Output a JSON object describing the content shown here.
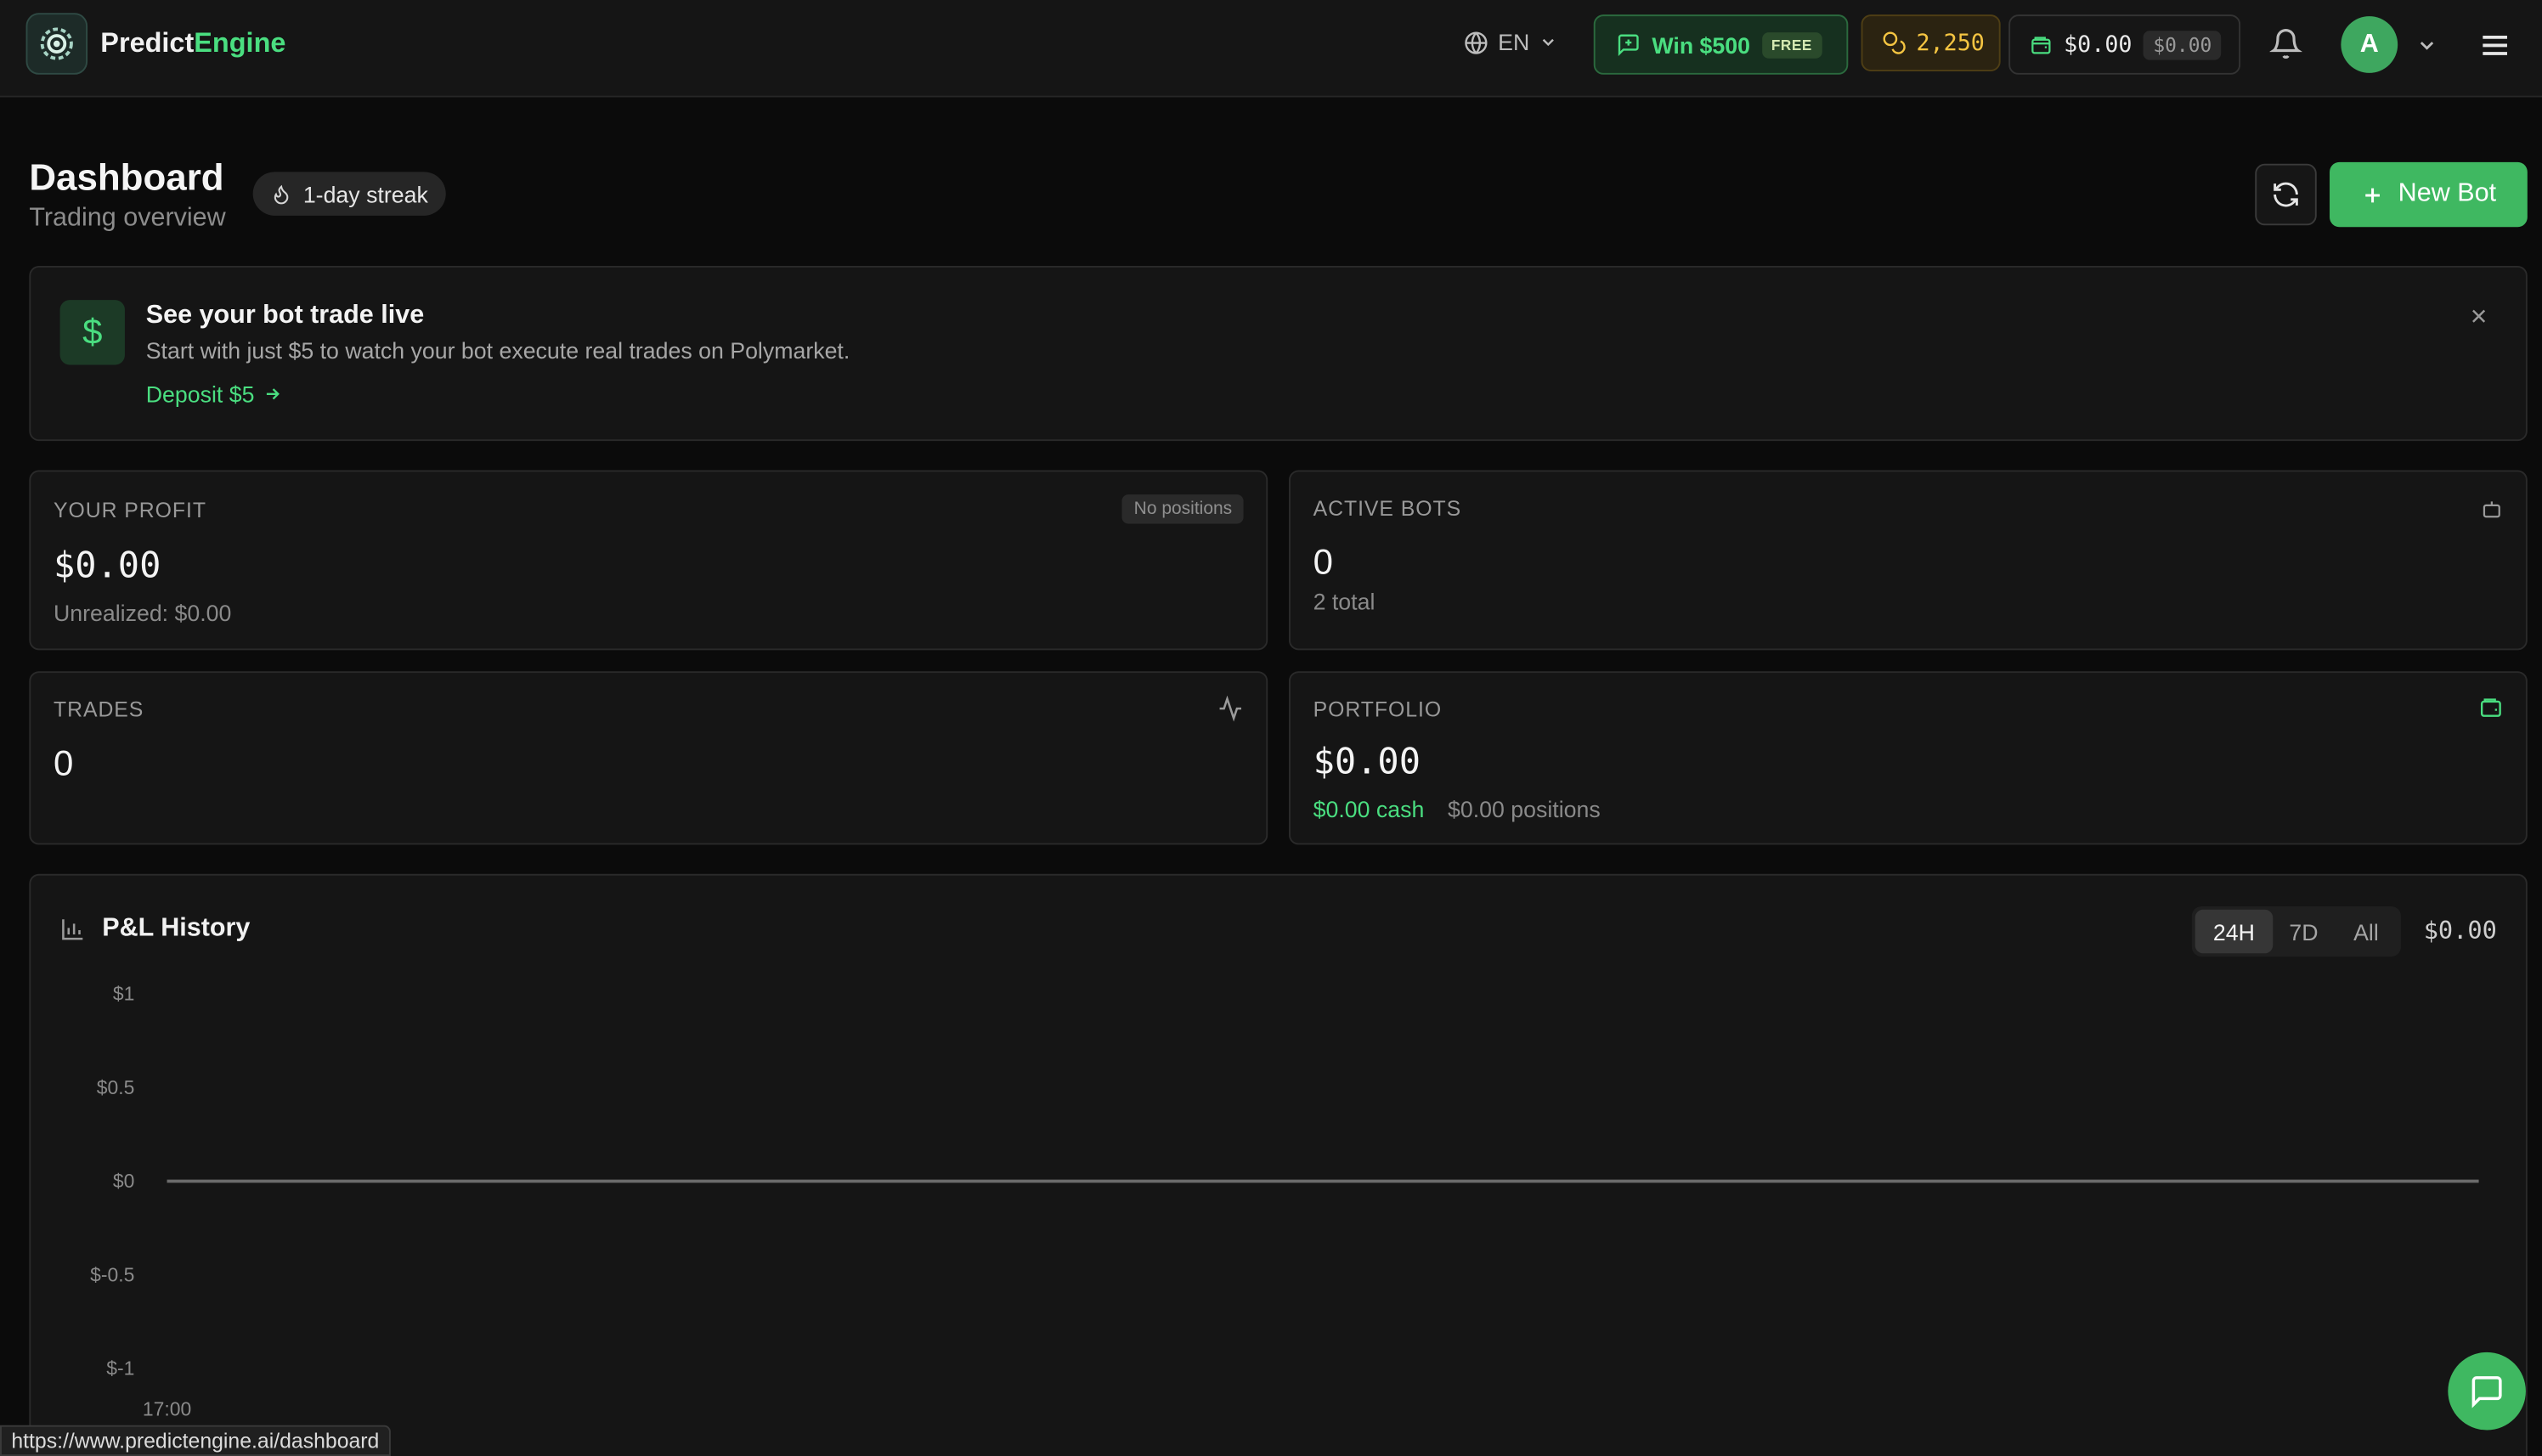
{
  "header": {
    "brand_part1": "Predict",
    "brand_part2": "Engine",
    "language": "EN",
    "win_label": "Win $500",
    "win_badge": "FREE",
    "coins": "2,250",
    "wallet_balance": "$0.00",
    "wallet_secondary": "$0.00",
    "avatar_initial": "A"
  },
  "page": {
    "title": "Dashboard",
    "subtitle": "Trading overview",
    "streak": "1-day streak",
    "new_bot_label": "New Bot"
  },
  "promo": {
    "title": "See your bot trade live",
    "text": "Start with just $5 to watch your bot execute real trades on Polymarket.",
    "link": "Deposit $5"
  },
  "stats": {
    "profit": {
      "label": "YOUR PROFIT",
      "badge": "No positions",
      "value": "$0.00",
      "sub": "Unrealized: $0.00"
    },
    "active_bots": {
      "label": "ACTIVE BOTS",
      "value": "0",
      "sub": "2 total"
    },
    "trades": {
      "label": "TRADES",
      "value": "0"
    },
    "portfolio": {
      "label": "PORTFOLIO",
      "value": "$0.00",
      "cash": "$0.00 cash",
      "positions": "$0.00 positions"
    }
  },
  "chart": {
    "title": "P&L History",
    "ranges": [
      "24H",
      "7D",
      "All"
    ],
    "active_range": "24H",
    "total": "$0.00"
  },
  "chart_data": {
    "type": "line",
    "title": "P&L History",
    "x": [
      "17:00"
    ],
    "x_tick_labels": [
      "17:00"
    ],
    "y_tick_labels": [
      "$1",
      "$0.5",
      "$0",
      "$-0.5",
      "$-1"
    ],
    "ylim": [
      -1,
      1
    ],
    "series": [
      {
        "values": [
          0,
          0
        ]
      }
    ],
    "grid": false,
    "colors": {
      "line": "#6b6b6b"
    }
  },
  "status_url": "https://www.predictengine.ai/dashboard",
  "colors": {
    "accent": "#3fb861",
    "accent_text": "#4ade80",
    "gold": "#f5c542",
    "background": "#0b0b0b"
  }
}
